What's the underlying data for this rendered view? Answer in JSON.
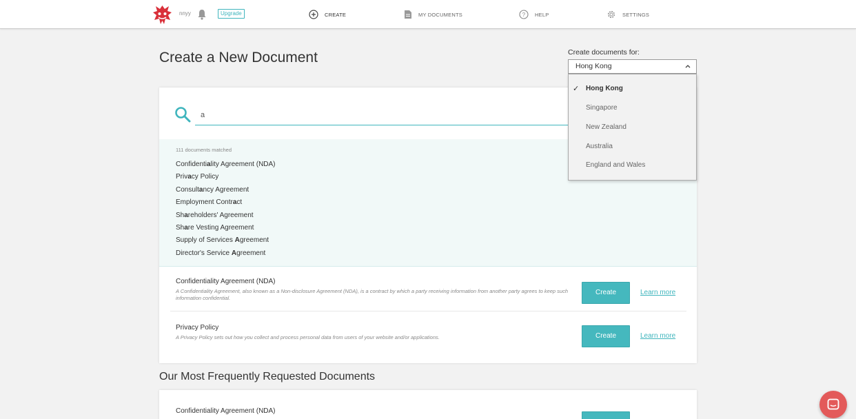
{
  "header": {
    "username": "nnyy",
    "upgrade_label": "Upgrade",
    "nav": {
      "create": "CREATE",
      "my_documents": "MY DOCUMENTS",
      "help": "HELP",
      "settings": "SETTINGS"
    }
  },
  "page": {
    "title": "Create a New Document",
    "country_label": "Create documents for:",
    "country_selected": "Hong Kong"
  },
  "search": {
    "query": "a",
    "match_count": "111 documents matched",
    "results": [
      {
        "pre": "Confidenti",
        "hl": "a",
        "post": "lity Agreement (NDA)"
      },
      {
        "pre": "Priv",
        "hl": "a",
        "post": "cy Policy"
      },
      {
        "pre": "Consult",
        "hl": "a",
        "post": "ncy Agreement"
      },
      {
        "pre": "Employment Contr",
        "hl": "a",
        "post": "ct"
      },
      {
        "pre": "Sh",
        "hl": "a",
        "post": "reholders' Agreement"
      },
      {
        "pre": "Sh",
        "hl": "a",
        "post": "re Vesting Agreement"
      },
      {
        "pre": "Supply of Services ",
        "hl": "A",
        "post": "greement"
      },
      {
        "pre": "Director's Service ",
        "hl": "A",
        "post": "greement"
      }
    ]
  },
  "documents": [
    {
      "title": "Confidentiality Agreement (NDA)",
      "description": "A Confidentiality Agreement, also known as a Non-disclosure Agreement (NDA), is a contract by which a party receiving information from another party agrees to keep such information confidential.",
      "create_label": "Create",
      "learn_label": "Learn more"
    },
    {
      "title": "Privacy Policy",
      "description": "A Privacy Policy sets out how you collect and process personal data from users of your website and/or applications.",
      "create_label": "Create",
      "learn_label": "Learn more"
    }
  ],
  "dropdown": {
    "options": [
      "Hong Kong",
      "Singapore",
      "New Zealand",
      "Australia",
      "England and Wales"
    ],
    "check": "✓"
  },
  "frequent": {
    "title": "Our Most Frequently Requested Documents",
    "first_doc": "Confidentiality Agreement (NDA)"
  },
  "colors": {
    "accent": "#45b8be",
    "chat": "#e35a5a"
  }
}
